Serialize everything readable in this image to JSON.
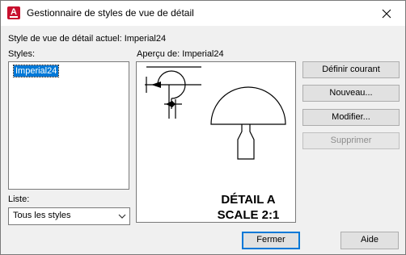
{
  "window": {
    "title": "Gestionnaire de styles de vue de détail",
    "close_icon": "close-icon"
  },
  "current_style": {
    "label": "Style de vue de détail actuel: Imperial24"
  },
  "styles": {
    "label": "Styles:",
    "items": [
      "Imperial24"
    ],
    "selected": "Imperial24"
  },
  "preview": {
    "label": "Aperçu de: Imperial24",
    "detail_line1": "DÉTAIL A",
    "detail_line2": "SCALE 2:1"
  },
  "list_filter": {
    "label": "Liste:",
    "selected": "Tous les styles"
  },
  "buttons": {
    "set_current": "Définir courant",
    "new": "Nouveau...",
    "modify": "Modifier...",
    "delete": "Supprimer",
    "close": "Fermer",
    "help": "Aide"
  },
  "colors": {
    "selection": "#0078d7",
    "app_icon": "#c8102e"
  }
}
